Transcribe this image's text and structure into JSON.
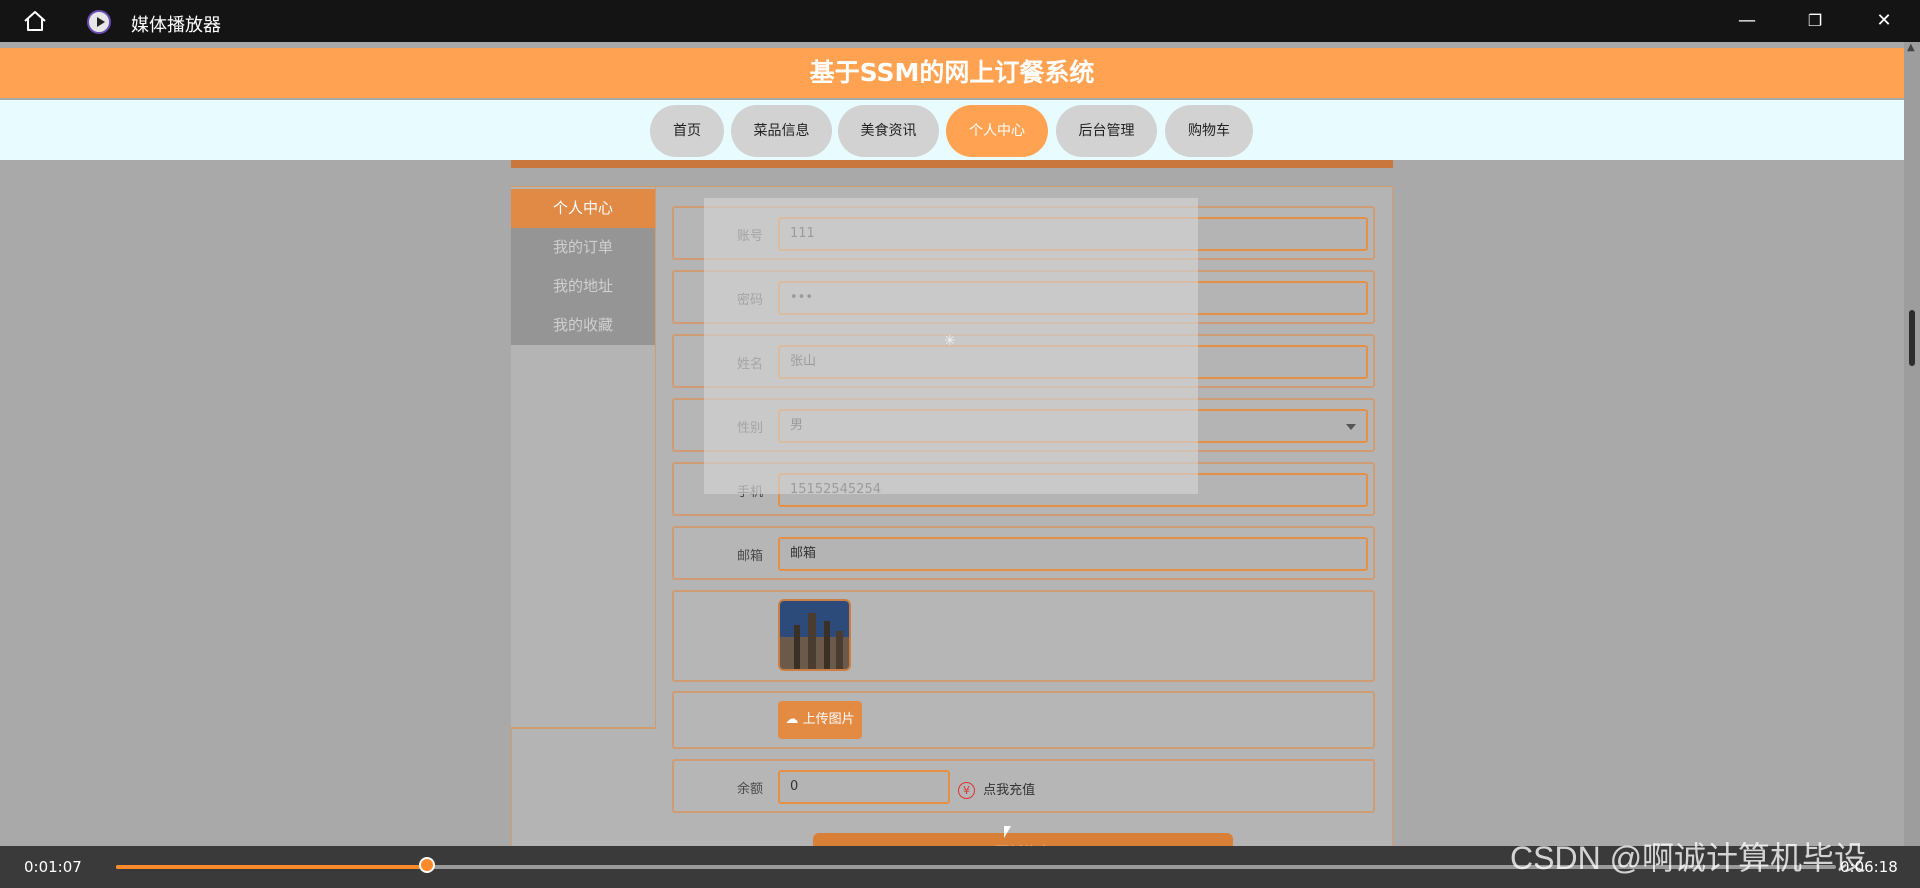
{
  "window": {
    "title": "媒体播放器",
    "minimize_label": "—",
    "restore_label": "❐",
    "close_label": "✕"
  },
  "site": {
    "header_title": "基于SSM的网上订餐系统"
  },
  "nav": {
    "items": [
      {
        "label": "首页",
        "active": false
      },
      {
        "label": "菜品信息",
        "active": false
      },
      {
        "label": "美食资讯",
        "active": false
      },
      {
        "label": "个人中心",
        "active": true
      },
      {
        "label": "后台管理",
        "active": false
      },
      {
        "label": "购物车",
        "active": false
      }
    ]
  },
  "sidebar": {
    "items": [
      {
        "label": "个人中心",
        "active": true
      },
      {
        "label": "我的订单",
        "active": false
      },
      {
        "label": "我的地址",
        "active": false
      },
      {
        "label": "我的收藏",
        "active": false
      }
    ]
  },
  "form": {
    "account_label": "账号",
    "account_value": "111",
    "password_label": "密码",
    "password_value": "•••",
    "name_label": "姓名",
    "name_value": "张山",
    "gender_label": "性别",
    "gender_value": "男",
    "phone_label": "手机",
    "phone_value": "15152545254",
    "email_label": "邮箱",
    "email_value": "邮箱",
    "upload_label": "上传图片",
    "balance_label": "余额",
    "balance_value": "0",
    "recharge_label": "点我充值",
    "recharge_icon": "¥",
    "submit_label": "更新信息"
  },
  "overlay": {
    "spinner": "✳"
  },
  "player": {
    "current_time": "0:01:07",
    "total_time": "0:06:18",
    "progress": 0.181
  },
  "watermark": {
    "text": "CSDN @啊诚计算机毕设"
  },
  "colors": {
    "accent": "#ffa352",
    "progress": "#ff8a2b"
  }
}
